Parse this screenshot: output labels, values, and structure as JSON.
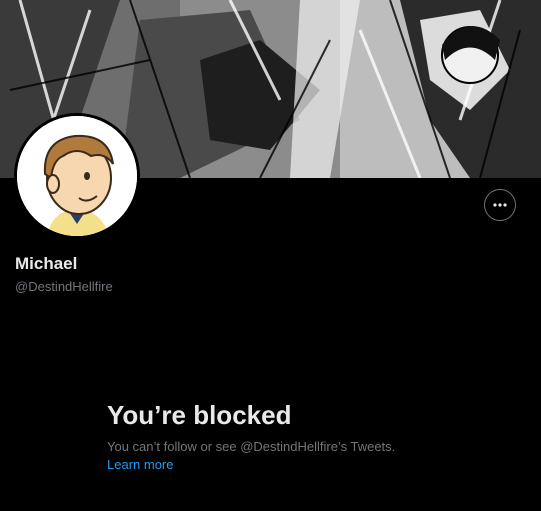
{
  "profile": {
    "display_name": "Michael",
    "handle": "@DestindHellfire"
  },
  "header": {
    "banner_alt": "banner-image",
    "avatar_alt": "avatar"
  },
  "actions": {
    "more_icon": "more-horizontal-icon"
  },
  "blocked": {
    "title": "You’re blocked",
    "message": "You can’t follow or see @DestindHellfire’s Tweets.",
    "learn_more": "Learn more"
  },
  "colors": {
    "background": "#000000",
    "primary_text": "#e7e9ea",
    "secondary_text": "#71767b",
    "link": "#1d9bf0"
  }
}
